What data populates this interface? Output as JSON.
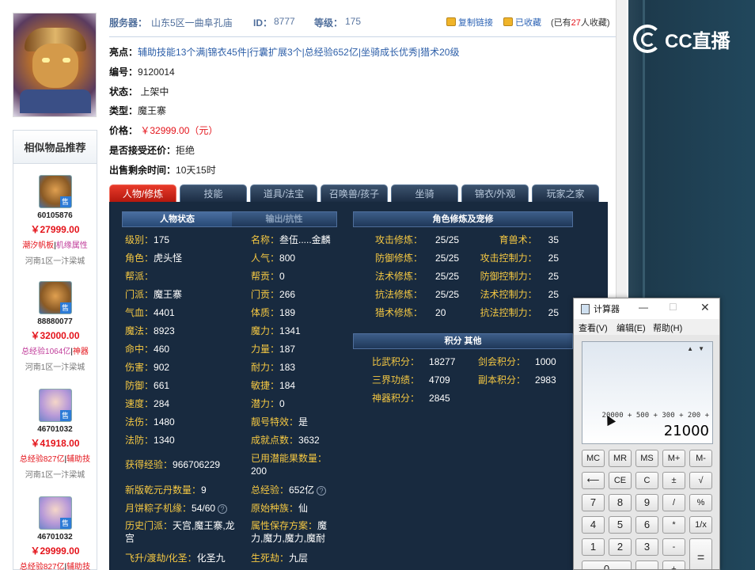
{
  "header": {
    "server_label": "服务器：",
    "server_value": "山东5区一曲阜孔庙",
    "id_label": "ID：",
    "id_value": "8777",
    "level_label": "等级：",
    "level_value": "175",
    "copy_link": "复制链接",
    "favorited": "已收藏",
    "fav_prefix": "(已有",
    "fav_count": "27",
    "fav_suffix": "人收藏)"
  },
  "highlights": {
    "label": "亮点：",
    "items": [
      "辅助技能13个满",
      "锦衣45件",
      "行囊扩展3个",
      "总经验652亿",
      "坐骑成长优秀",
      "猎术20级"
    ],
    "sep": "|"
  },
  "details": [
    {
      "key": "编号：",
      "value": "9120014"
    },
    {
      "key": "状态：",
      "value": " 上架中"
    },
    {
      "key": "类型：",
      "value": "魔王寨"
    },
    {
      "key": "价格：",
      "value": " ￥32999.00（元）"
    },
    {
      "key": "是否接受还价：",
      "value": "拒绝"
    },
    {
      "key": "出售剩余时间：",
      "value": "10天15时"
    }
  ],
  "similar": {
    "title": "相似物品推荐",
    "items": [
      {
        "id": "60105876",
        "price": "￥27999.00",
        "tag1": "潮汐帆板",
        "tag2": "机缘属性",
        "server": "河南1区一汴梁城"
      },
      {
        "id": "88880077",
        "price": "￥32000.00",
        "tag1": "总经验1064亿",
        "tag2": "神器",
        "server": "河南1区一汴梁城"
      },
      {
        "id": "46701032",
        "price": "￥41918.00",
        "tag1": "总经验827亿",
        "tag2": "辅助技",
        "server": "河南1区一汴梁城"
      },
      {
        "id": "46701032",
        "price": "￥29999.00",
        "tag1": "总经验827亿",
        "tag2": "辅助技",
        "server": ""
      }
    ],
    "sell_badge": "售",
    "sep": "|"
  },
  "tabs": [
    "人物/修炼",
    "技能",
    "道具/法宝",
    "召唤兽/孩子",
    "坐骑",
    "锦衣/外观",
    "玩家之家"
  ],
  "panel": {
    "char_tab_on": "人物状态",
    "char_tab_off": "输出/抗性",
    "cultivation_title": "角色修炼及宠修",
    "points_title": "积分 其他",
    "stats_left": [
      {
        "k": "级别：",
        "v": "175"
      },
      {
        "k": "角色：",
        "v": "虎头怪"
      },
      {
        "k": "帮派：",
        "v": ""
      },
      {
        "k": "门派：",
        "v": "魔王寨"
      },
      {
        "k": "气血：",
        "v": "4401"
      },
      {
        "k": "魔法：",
        "v": "8923"
      },
      {
        "k": "命中：",
        "v": "460"
      },
      {
        "k": "伤害：",
        "v": "902"
      },
      {
        "k": "防御：",
        "v": "661"
      },
      {
        "k": "速度：",
        "v": "284"
      },
      {
        "k": "法伤：",
        "v": "1480"
      },
      {
        "k": "法防：",
        "v": "1340"
      }
    ],
    "stats_right": [
      {
        "k": "名称：",
        "v": "叁伍.....金麟"
      },
      {
        "k": "人气：",
        "v": "800"
      },
      {
        "k": "帮贡：",
        "v": "0"
      },
      {
        "k": "门贡：",
        "v": "266"
      },
      {
        "k": "体质：",
        "v": "189"
      },
      {
        "k": "魔力：",
        "v": "1341"
      },
      {
        "k": "力量：",
        "v": "187"
      },
      {
        "k": "耐力：",
        "v": "183"
      },
      {
        "k": "敏捷：",
        "v": "184"
      },
      {
        "k": "潜力：",
        "v": "0"
      },
      {
        "k": "靓号特效：",
        "v": "是"
      },
      {
        "k": "成就点数：",
        "v": "3632"
      }
    ],
    "exp": {
      "k": "获得经验：",
      "v": "966706229"
    },
    "used_fruit": {
      "k": "已用潜能果数量：",
      "v": "200"
    },
    "new_pill": {
      "k": "新版乾元丹数量：",
      "v": "9"
    },
    "total_exp": {
      "k": "总经验：",
      "v": "652亿"
    },
    "mooncake": {
      "k": "月饼粽子机缘：",
      "v": "54/60"
    },
    "orig_race": {
      "k": "原始种族：",
      "v": "仙"
    },
    "history_sect": {
      "k": "历史门派：",
      "v": "天宫,魔王寨,龙宫"
    },
    "attr_save": {
      "k": "属性保存方案：",
      "v": "魔力,魔力,魔力,魔耐"
    },
    "ascend": {
      "k": "飞升/渡劫/化圣：",
      "v": "化圣九"
    },
    "life_death": {
      "k": "生死劫：",
      "v": "九层"
    },
    "cultivation": [
      {
        "k": "攻击修炼：",
        "v": "25/25",
        "k2": "育兽术：",
        "v2": "35"
      },
      {
        "k": "防御修炼：",
        "v": "25/25",
        "k2": "攻击控制力：",
        "v2": "25"
      },
      {
        "k": "法术修炼：",
        "v": "25/25",
        "k2": "防御控制力：",
        "v2": "25"
      },
      {
        "k": "抗法修炼：",
        "v": "25/25",
        "k2": "法术控制力：",
        "v2": "25"
      },
      {
        "k": "猎术修炼：",
        "v": "20",
        "k2": "抗法控制力：",
        "v2": "25"
      }
    ],
    "points": [
      {
        "k": "比武积分：",
        "v": "18277",
        "k2": "剑会积分：",
        "v2": "1000"
      },
      {
        "k": "三界功绩：",
        "v": "4709",
        "k2": "副本积分：",
        "v2": "2983"
      },
      {
        "k": "神器积分：",
        "v": "2845",
        "k2": "",
        "v2": ""
      }
    ]
  },
  "calculator": {
    "title": "计算器",
    "menu": [
      "查看(V)",
      "编辑(E)",
      "帮助(H)"
    ],
    "expression": "20000 + 500 + 300 + 200 +",
    "result": "21000",
    "keys": [
      [
        "MC",
        "MR",
        "MS",
        "M+",
        "M-"
      ],
      [
        "⟵",
        "CE",
        "C",
        "±",
        "√"
      ],
      [
        "7",
        "8",
        "9",
        "/",
        "%"
      ],
      [
        "4",
        "5",
        "6",
        "*",
        "1/x"
      ],
      [
        "1",
        "2",
        "3",
        "-",
        "="
      ],
      [
        "0",
        "",
        ".",
        "+",
        ""
      ]
    ]
  },
  "brand": {
    "logo_text": "CC直播"
  },
  "colors": {
    "price_red": "#e4141b",
    "panel_bg": "#182a3f",
    "stat_key": "#f5c842",
    "tab_active": "#d42a1c"
  }
}
